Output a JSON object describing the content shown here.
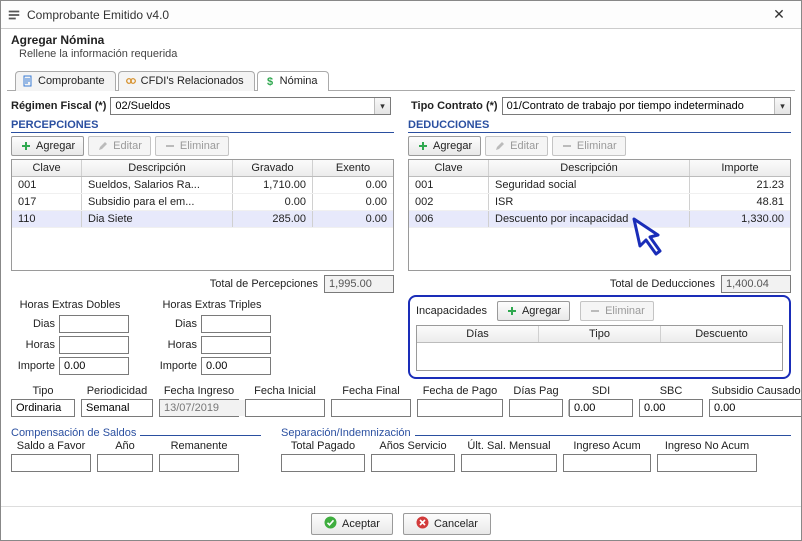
{
  "window": {
    "title": "Comprobante Emitido v4.0"
  },
  "header": {
    "title": "Agregar Nómina",
    "subtitle": "Rellene la información requerida"
  },
  "tabs": {
    "t0": "Comprobante",
    "t1": "CFDI's Relacionados",
    "t2": "Nómina"
  },
  "fields": {
    "regimen_label": "Régimen Fiscal (*)",
    "regimen_value": "02/Sueldos",
    "tipocontrato_label": "Tipo Contrato (*)",
    "tipocontrato_value": "01/Contrato de trabajo por tiempo indeterminado"
  },
  "percepciones": {
    "title": "PERCEPCIONES",
    "btn_add": "Agregar",
    "btn_edit": "Editar",
    "btn_del": "Eliminar",
    "cols": {
      "clave": "Clave",
      "desc": "Descripción",
      "grav": "Gravado",
      "exen": "Exento"
    },
    "rows": [
      {
        "clave": "001",
        "desc": "Sueldos, Salarios  Ra...",
        "grav": "1,710.00",
        "exen": "0.00"
      },
      {
        "clave": "017",
        "desc": "Subsidio para el em...",
        "grav": "0.00",
        "exen": "0.00"
      },
      {
        "clave": "110",
        "desc": "Dia Siete",
        "grav": "285.00",
        "exen": "0.00"
      }
    ],
    "total_label": "Total de Percepciones",
    "total": "1,995.00"
  },
  "deducciones": {
    "title": "DEDUCCIONES",
    "btn_add": "Agregar",
    "btn_edit": "Editar",
    "btn_del": "Eliminar",
    "cols": {
      "clave": "Clave",
      "desc": "Descripción",
      "imp": "Importe"
    },
    "rows": [
      {
        "clave": "001",
        "desc": "Seguridad social",
        "imp": "21.23"
      },
      {
        "clave": "002",
        "desc": "ISR",
        "imp": "48.81"
      },
      {
        "clave": "006",
        "desc": "Descuento por incapacidad",
        "imp": "1,330.00"
      }
    ],
    "total_label": "Total de Deducciones",
    "total": "1,400.04"
  },
  "horas_extras": {
    "dobles": "Horas Extras Dobles",
    "triples": "Horas Extras Triples",
    "dias": "Dias",
    "horas": "Horas",
    "importe": "Importe",
    "dobles_importe": "0.00",
    "triples_importe": "0.00"
  },
  "incapacidades": {
    "title": "Incapacidades",
    "btn_add": "Agregar",
    "btn_del": "Eliminar",
    "cols": {
      "dias": "Días",
      "tipo": "Tipo",
      "desc": "Descuento"
    }
  },
  "bottom": {
    "tipo": "Tipo",
    "tipo_val": "Ordinaria",
    "periodicidad": "Periodicidad",
    "periodicidad_val": "Semanal",
    "fecha_ingreso": "Fecha Ingreso",
    "fecha_ingreso_val": "13/07/2019",
    "fecha_inicial": "Fecha Inicial",
    "fecha_final": "Fecha Final",
    "fecha_pago": "Fecha de Pago",
    "dias_pag": "Días Pag",
    "sdi": "SDI",
    "sdi_val": "0.00",
    "sbc": "SBC",
    "sbc_val": "0.00",
    "subsidio": "Subsidio Causado",
    "subsidio_val": "0.00"
  },
  "comp_saldos": {
    "title": "Compensación de Saldos",
    "saldo_favor": "Saldo a Favor",
    "anio": "Año",
    "remanente": "Remanente"
  },
  "sep_indem": {
    "title": "Separación/Indemnización",
    "total_pagado": "Total Pagado",
    "anios_servicio": "Años Servicio",
    "ult_sal": "Últ. Sal. Mensual",
    "ingreso_acum": "Ingreso Acum",
    "ingreso_no_acum": "Ingreso No Acum"
  },
  "footer": {
    "aceptar": "Aceptar",
    "cancelar": "Cancelar"
  }
}
